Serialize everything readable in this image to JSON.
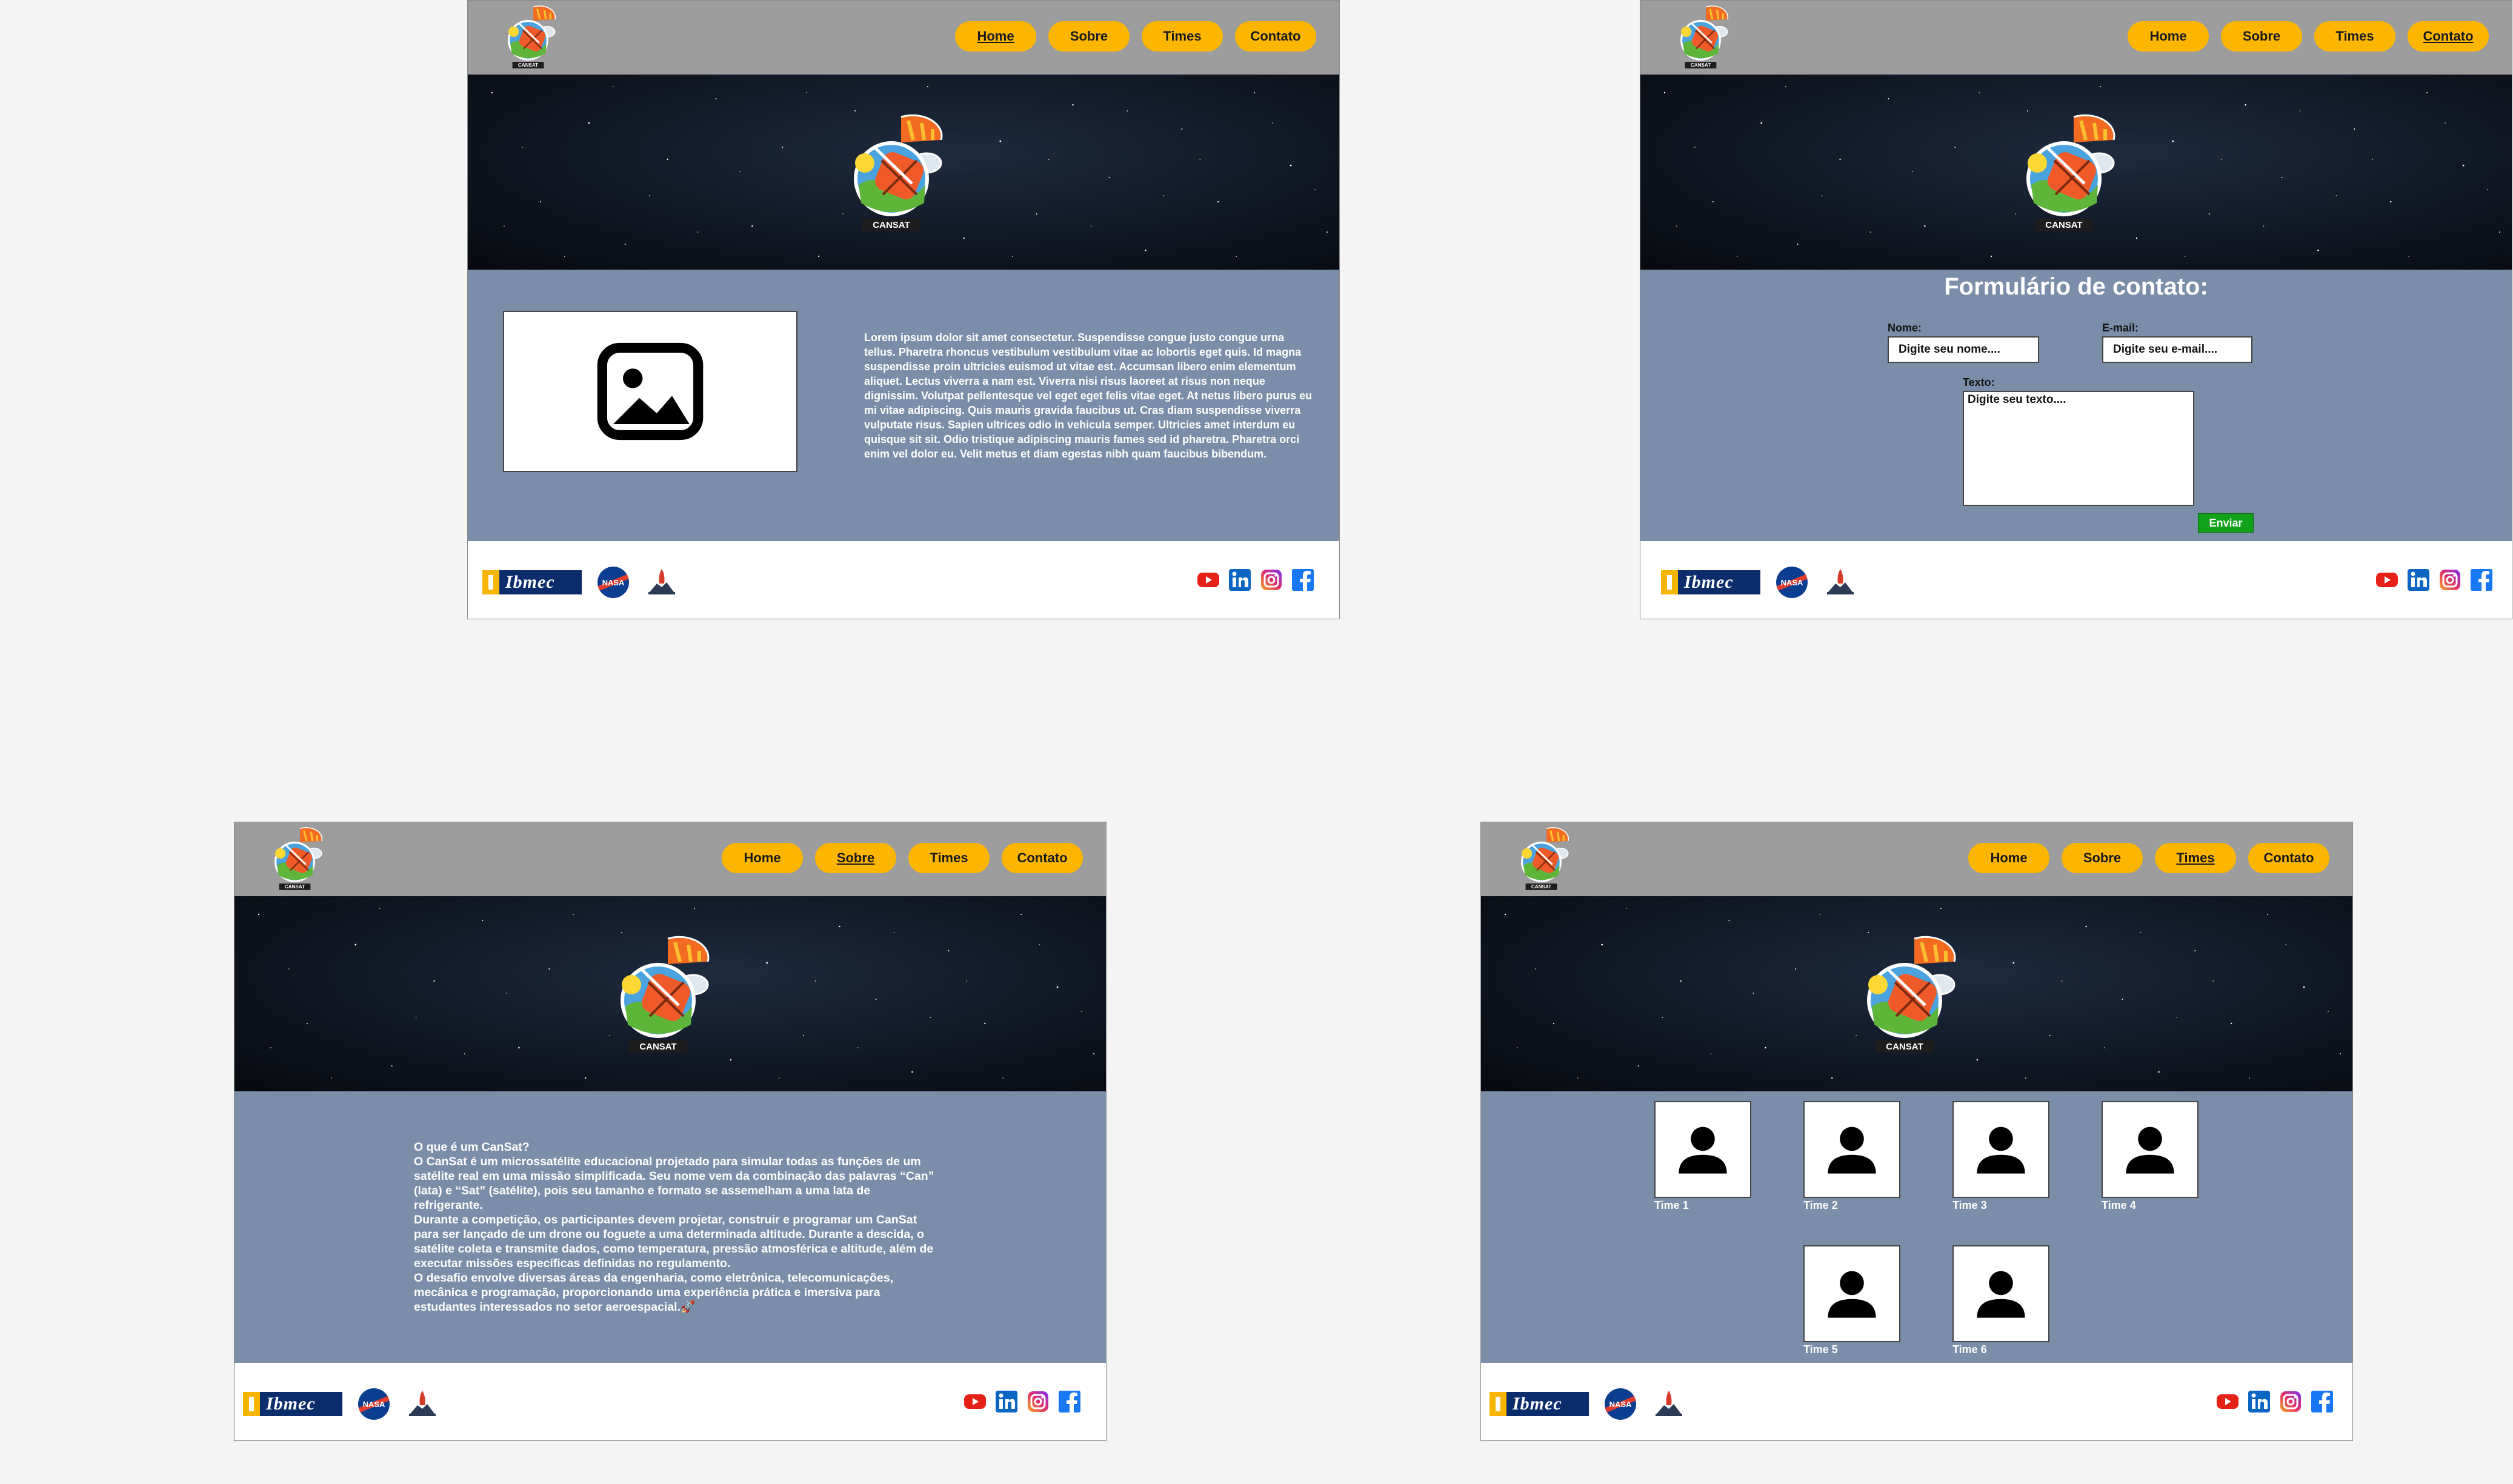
{
  "nav": {
    "home": "Home",
    "sobre": "Sobre",
    "times": "Times",
    "contato": "Contato"
  },
  "brand": {
    "logo_text": "CANSAT",
    "nasa_text": "NASA",
    "ibmec_text": "Ibmec"
  },
  "colors": {
    "header_bg": "#9d9d9d",
    "nav_button": "#fdb600",
    "content_bg": "#7a8ea9",
    "send_button": "#11a21a"
  },
  "icons": {
    "image_placeholder": "image-icon",
    "team_photo": "user-icon",
    "socials": [
      "youtube-icon",
      "linkedin-icon",
      "instagram-icon",
      "facebook-icon"
    ]
  },
  "home": {
    "body": "Lorem ipsum dolor sit amet consectetur. Suspendisse congue justo congue urna tellus. Pharetra rhoncus vestibulum vestibulum vitae ac lobortis eget quis. Id magna suspendisse proin ultricies euismod ut vitae est. Accumsan libero enim elementum aliquet. Lectus viverra a nam est. Viverra nisi risus laoreet at risus non neque dignissim. Volutpat pellentesque vel eget eget felis vitae eget. At netus libero purus eu mi vitae adipiscing. Quis mauris gravida faucibus ut. Cras diam suspendisse viverra vulputate risus. Sapien ultrices odio in vehicula semper. Ultricies amet interdum eu quisque sit sit. Odio tristique adipiscing mauris fames sed id pharetra. Pharetra orci enim vel dolor eu. Velit metus et diam egestas nibh quam faucibus bibendum."
  },
  "contato": {
    "title": "Formulário de contato:",
    "name_label": "Nome:",
    "name_placeholder": "Digite seu nome....",
    "email_label": "E-mail:",
    "email_placeholder": "Digite seu e-mail....",
    "text_label": "Texto:",
    "text_placeholder": "Digite seu texto....",
    "send_label": "Enviar"
  },
  "sobre": {
    "paragraphs": [
      "O que é um CanSat?",
      "O CanSat é um microssatélite educacional projetado para simular todas as funções de um satélite real em uma missão simplificada. Seu nome vem da combinação das palavras “Can” (lata) e “Sat” (satélite), pois seu tamanho e formato se assemelham a uma lata de refrigerante.",
      "Durante a competição, os participantes devem projetar, construir e programar um CanSat para ser lançado de um drone ou foguete a uma determinada altitude. Durante a descida, o satélite coleta e transmite dados, como temperatura, pressão atmosférica e altitude, além de executar missões específicas definidas no regulamento.",
      "O desafio envolve diversas áreas da engenharia, como eletrônica, telecomunicações, mecânica e programação, proporcionando uma experiência prática e imersiva para estudantes interessados no setor aeroespacial.🚀"
    ]
  },
  "times": {
    "teams": [
      "Time 1",
      "Time 2",
      "Time 3",
      "Time 4",
      "Time 5",
      "Time 6"
    ]
  }
}
